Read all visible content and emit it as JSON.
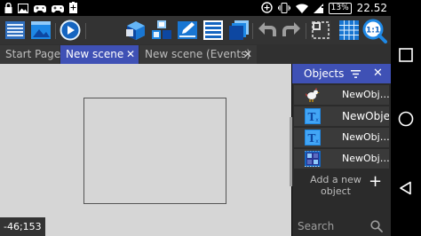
{
  "status_bar": {
    "icons": [
      "lock-icon",
      "image-icon",
      "gamepad-icon",
      "gamepad-icon",
      "add-box-icon",
      "battery-saver-icon",
      "vibrate-icon",
      "wifi-icon",
      "signal-icon"
    ],
    "battery": "13%",
    "time": "22.52"
  },
  "toolbar": {
    "buttons": [
      "project-manager",
      "scene-editor",
      "play-preview",
      "objects-list",
      "objects-groups",
      "properties",
      "layers",
      "object-instances",
      "undo",
      "redo",
      "show-mask",
      "grid",
      "zoom-reset"
    ],
    "zoom_label": "1:1"
  },
  "tabs": [
    {
      "label": "Start Page",
      "active": false,
      "closable": false
    },
    {
      "label": "New scene",
      "active": true,
      "closable": true
    },
    {
      "label": "New scene (Events)",
      "active": false,
      "closable": true
    }
  ],
  "scene": {
    "coordinates": "-46;153"
  },
  "objects_panel": {
    "title": "Objects",
    "items": [
      {
        "label": "NewObj…",
        "kind": "sprite"
      },
      {
        "label": "NewObje",
        "kind": "text"
      },
      {
        "label": "NewObj…",
        "kind": "text"
      },
      {
        "label": "NewObj…",
        "kind": "tiled"
      }
    ],
    "add_label": "Add a new object",
    "add_symbol": "+",
    "search_placeholder": "Search"
  },
  "colors": {
    "accent": "#3f51b5",
    "toolbar": "#333333",
    "scene_bg": "#d6d6d6",
    "panel_bg": "#2b2b2b"
  }
}
